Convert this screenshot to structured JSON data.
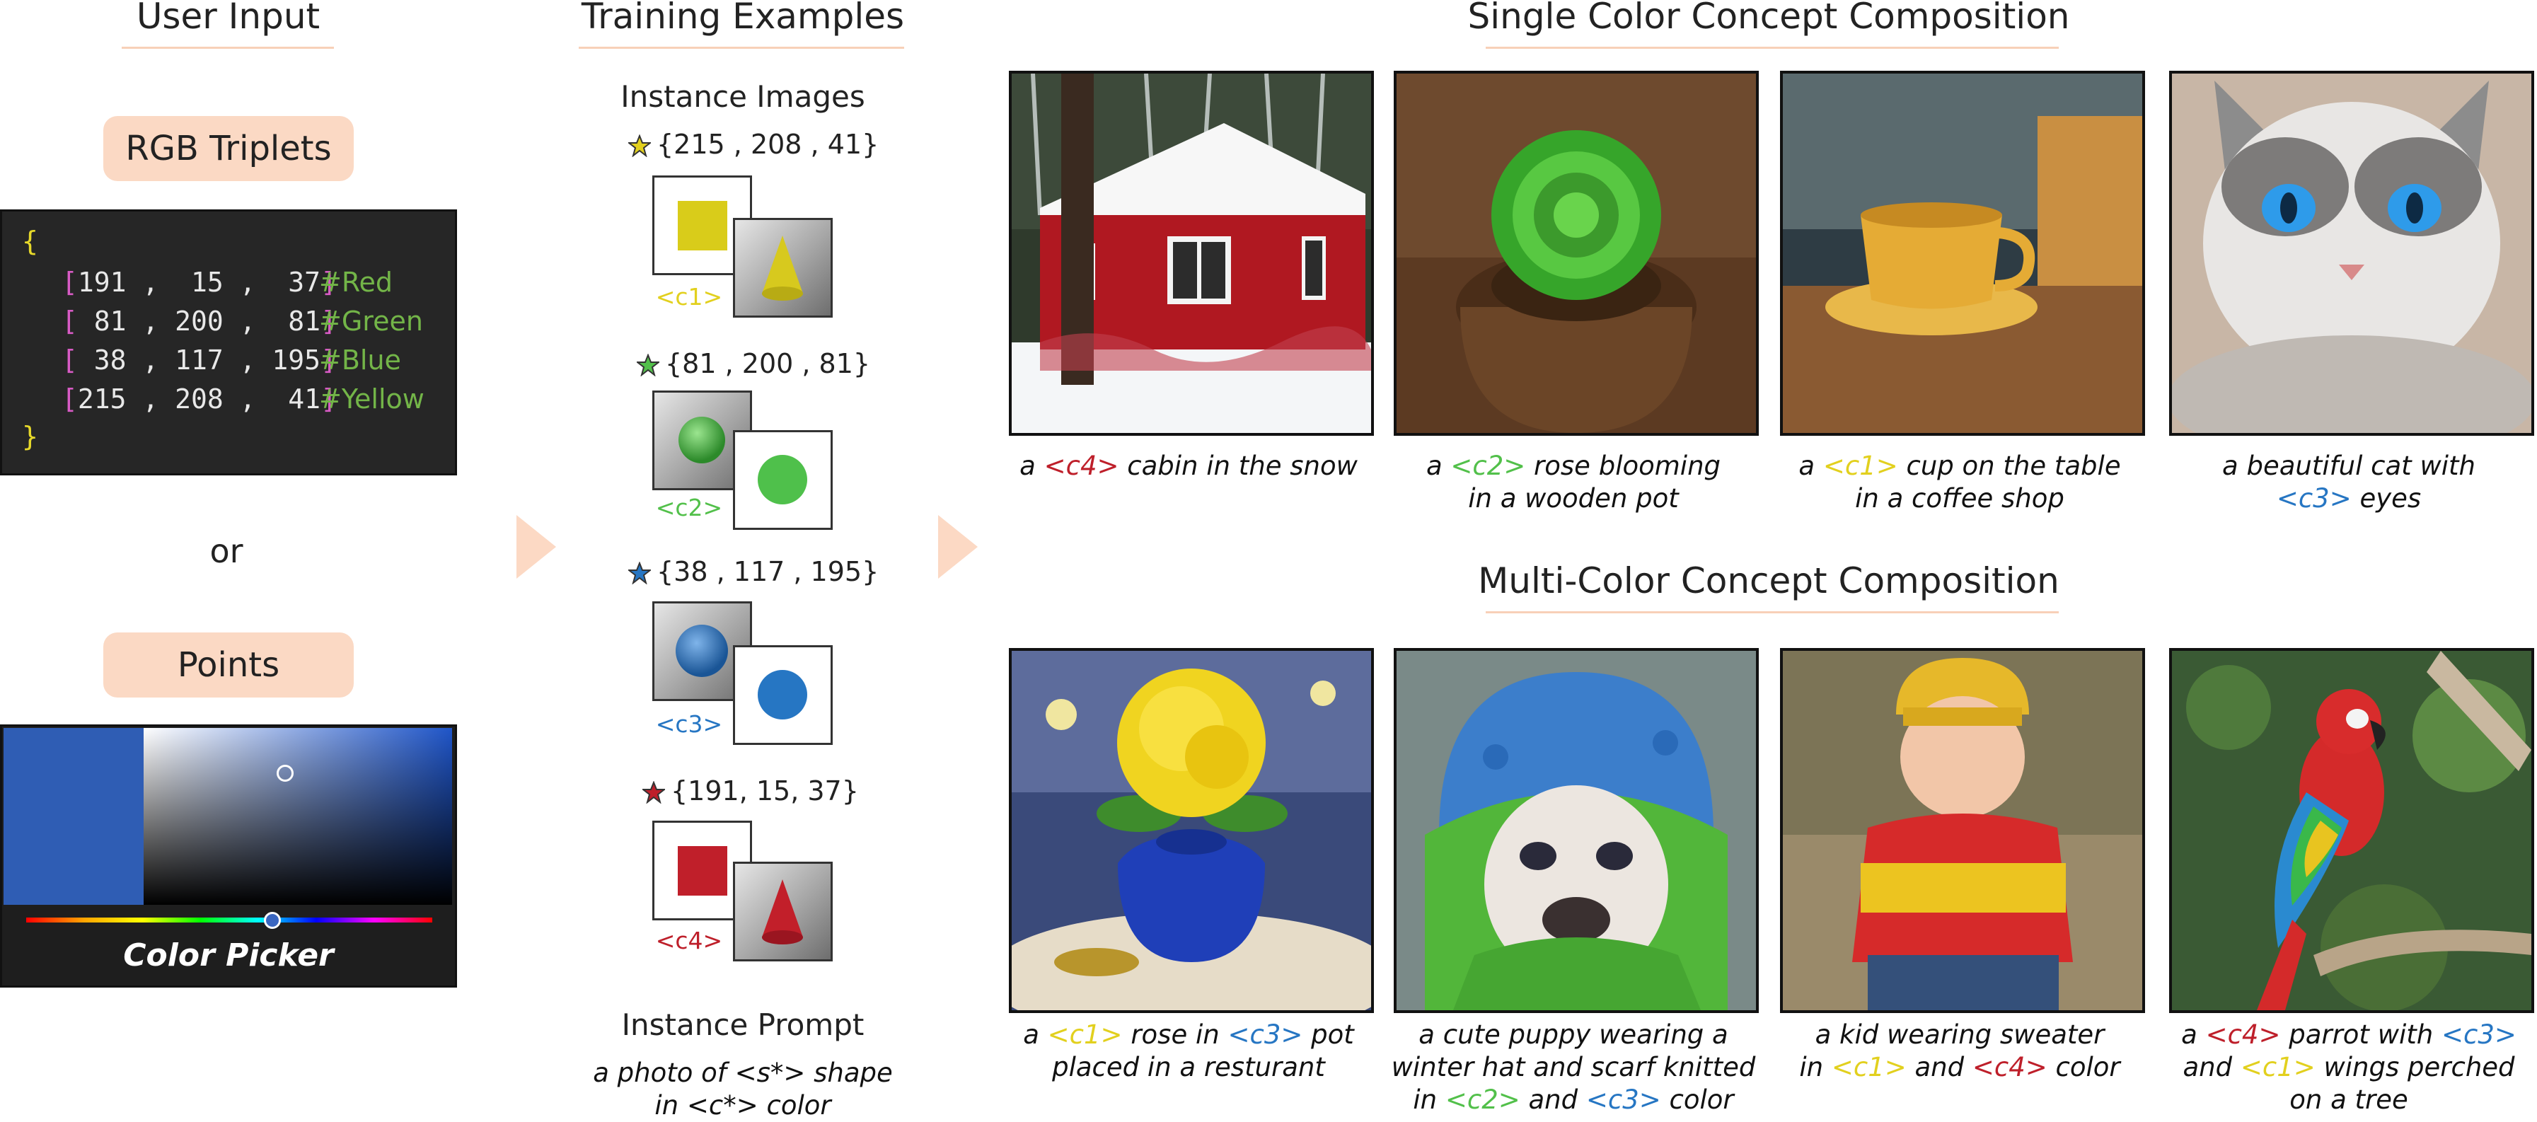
{
  "colors": {
    "red": "#be1f2a",
    "green": "#52c04a",
    "blue": "#2676c3",
    "yellow": "#e2d01e",
    "accent_peach": "#fbd9c4"
  },
  "left": {
    "title": "User Input",
    "rgb_label": "RGB Triplets",
    "code": {
      "open": "{",
      "close": "}",
      "rows": [
        {
          "values": "191 ,  15 ,  37",
          "comment": "#Red"
        },
        {
          "values": " 81 , 200 ,  81",
          "comment": "#Green"
        },
        {
          "values": " 38 , 117 , 195",
          "comment": "#Blue"
        },
        {
          "values": "215 , 208 ,  41",
          "comment": "#Yellow"
        }
      ]
    },
    "or_text": "or",
    "points_label": "Points",
    "picker_label": "Color Picker"
  },
  "middle": {
    "title": "Training Examples",
    "instance_images_label": "Instance Images",
    "items": [
      {
        "triplet": "{215 , 208 , 41}",
        "token": "<c1>",
        "star_color": "#e2d01e",
        "shape_color": "#d9cc1a"
      },
      {
        "triplet": "{81 , 200 , 81}",
        "token": "<c2>",
        "star_color": "#52c04a",
        "shape_color": "#4fc04b"
      },
      {
        "triplet": "{38 , 117 , 195}",
        "token": "<c3>",
        "star_color": "#2676c3",
        "shape_color": "#2676c3"
      },
      {
        "triplet": "{191, 15, 37}",
        "token": "<c4>",
        "star_color": "#be1f2a",
        "shape_color": "#c01f2a"
      }
    ],
    "instance_prompt_label": "Instance Prompt",
    "instance_prompt_line1": "a photo of <s*> shape",
    "instance_prompt_line2": "in <c*> color"
  },
  "right": {
    "single_title": "Single Color Concept Composition",
    "multi_title": "Multi-Color Concept Composition",
    "single_captions": [
      [
        [
          "a ",
          ""
        ],
        [
          "<c4>",
          "red"
        ],
        [
          " cabin in the snow",
          ""
        ]
      ],
      [
        [
          "a ",
          ""
        ],
        [
          "<c2>",
          "green"
        ],
        [
          " rose blooming",
          ""
        ],
        [
          "\n",
          ""
        ],
        [
          "in a wooden pot",
          ""
        ]
      ],
      [
        [
          "a ",
          ""
        ],
        [
          "<c1>",
          "yellow"
        ],
        [
          " cup on the table",
          ""
        ],
        [
          "\n",
          ""
        ],
        [
          "in a coffee shop",
          ""
        ]
      ],
      [
        [
          "a beautiful cat with",
          ""
        ],
        [
          "\n",
          ""
        ],
        [
          "<c3>",
          "blue"
        ],
        [
          " eyes",
          ""
        ]
      ]
    ],
    "multi_captions": [
      [
        [
          "a ",
          ""
        ],
        [
          "<c1>",
          "yellow"
        ],
        [
          " rose in ",
          ""
        ],
        [
          "<c3>",
          "blue"
        ],
        [
          " pot",
          ""
        ],
        [
          "\n",
          ""
        ],
        [
          "placed in a resturant",
          ""
        ]
      ],
      [
        [
          "a cute puppy wearing a",
          ""
        ],
        [
          "\n",
          ""
        ],
        [
          "winter hat and scarf knitted",
          ""
        ],
        [
          "\n",
          ""
        ],
        [
          "in ",
          ""
        ],
        [
          "<c2>",
          "green"
        ],
        [
          " and ",
          ""
        ],
        [
          "<c3>",
          "blue"
        ],
        [
          " color",
          ""
        ]
      ],
      [
        [
          "a kid wearing sweater",
          ""
        ],
        [
          "\n",
          ""
        ],
        [
          "in ",
          ""
        ],
        [
          "<c1>",
          "yellow"
        ],
        [
          " and ",
          ""
        ],
        [
          "<c4>",
          "red"
        ],
        [
          " color",
          ""
        ]
      ],
      [
        [
          "a ",
          ""
        ],
        [
          "<c4>",
          "red"
        ],
        [
          " parrot with ",
          ""
        ],
        [
          "<c3>",
          "blue"
        ],
        [
          "\n",
          ""
        ],
        [
          "and ",
          ""
        ],
        [
          "<c1>",
          "yellow"
        ],
        [
          " wings perched",
          ""
        ],
        [
          "\n",
          ""
        ],
        [
          "on a tree",
          ""
        ]
      ]
    ]
  }
}
